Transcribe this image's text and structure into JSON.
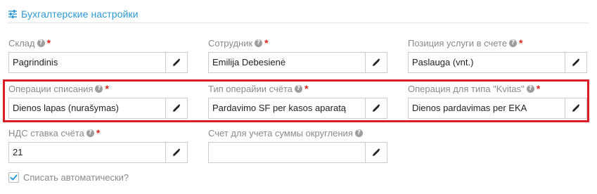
{
  "section": {
    "title": "Бухгалтерские настройки",
    "icon": "sliders-icon"
  },
  "fields": {
    "warehouse": {
      "label": "Склад",
      "value": "Pagrindinis"
    },
    "employee": {
      "label": "Сотрудник",
      "value": "Emilija Debesienė"
    },
    "service_position": {
      "label": "Позиция услуги в счете",
      "value": "Paslauga (vnt.)"
    },
    "write_off_operations": {
      "label": "Операции списания",
      "value": "Dienos lapas (nurašymas)"
    },
    "invoice_operation_type": {
      "label": "Тип операйии счёта",
      "value": "Pardavimo SF per kasos aparatą"
    },
    "kvitas_operation": {
      "label": "Операция для типа \"Kvitas\"",
      "value": "Dienos pardavimas per EKA"
    },
    "vat_rate": {
      "label": "НДС ставка счёта",
      "value": "21"
    },
    "rounding_account": {
      "label": "Счет для учета суммы округления",
      "value": ""
    }
  },
  "required_mark": "*",
  "help_glyph": "?",
  "auto_write_off": {
    "label": "Списать автоматически?",
    "checked": true
  },
  "colors": {
    "accent": "#2b9ad6",
    "required": "#e0261b",
    "highlight": "#dd1d26"
  }
}
